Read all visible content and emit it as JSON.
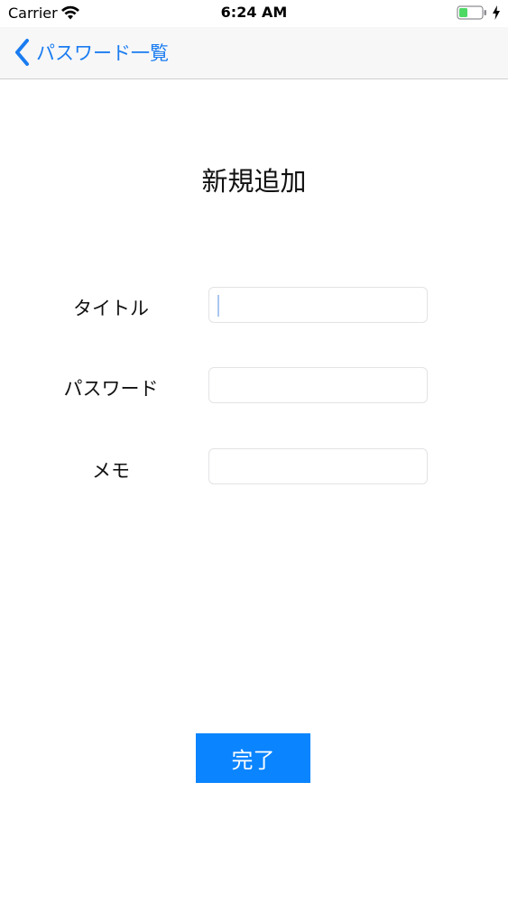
{
  "status_bar": {
    "carrier": "Carrier",
    "time": "6:24 AM",
    "battery_color": "#4cd964"
  },
  "nav": {
    "back_label": "パスワード一覧",
    "accent_color": "#1a7cf0"
  },
  "form": {
    "title": "新規追加",
    "fields": [
      {
        "label": "タイトル",
        "value": "",
        "placeholder": ""
      },
      {
        "label": "パスワード",
        "value": "",
        "placeholder": ""
      },
      {
        "label": "メモ",
        "value": "",
        "placeholder": ""
      }
    ],
    "submit_label": "完了",
    "submit_color": "#0a84ff"
  },
  "icons": {
    "wifi": "wifi-icon",
    "battery": "battery-icon",
    "charging": "charging-icon",
    "back": "chevron-left-icon"
  }
}
